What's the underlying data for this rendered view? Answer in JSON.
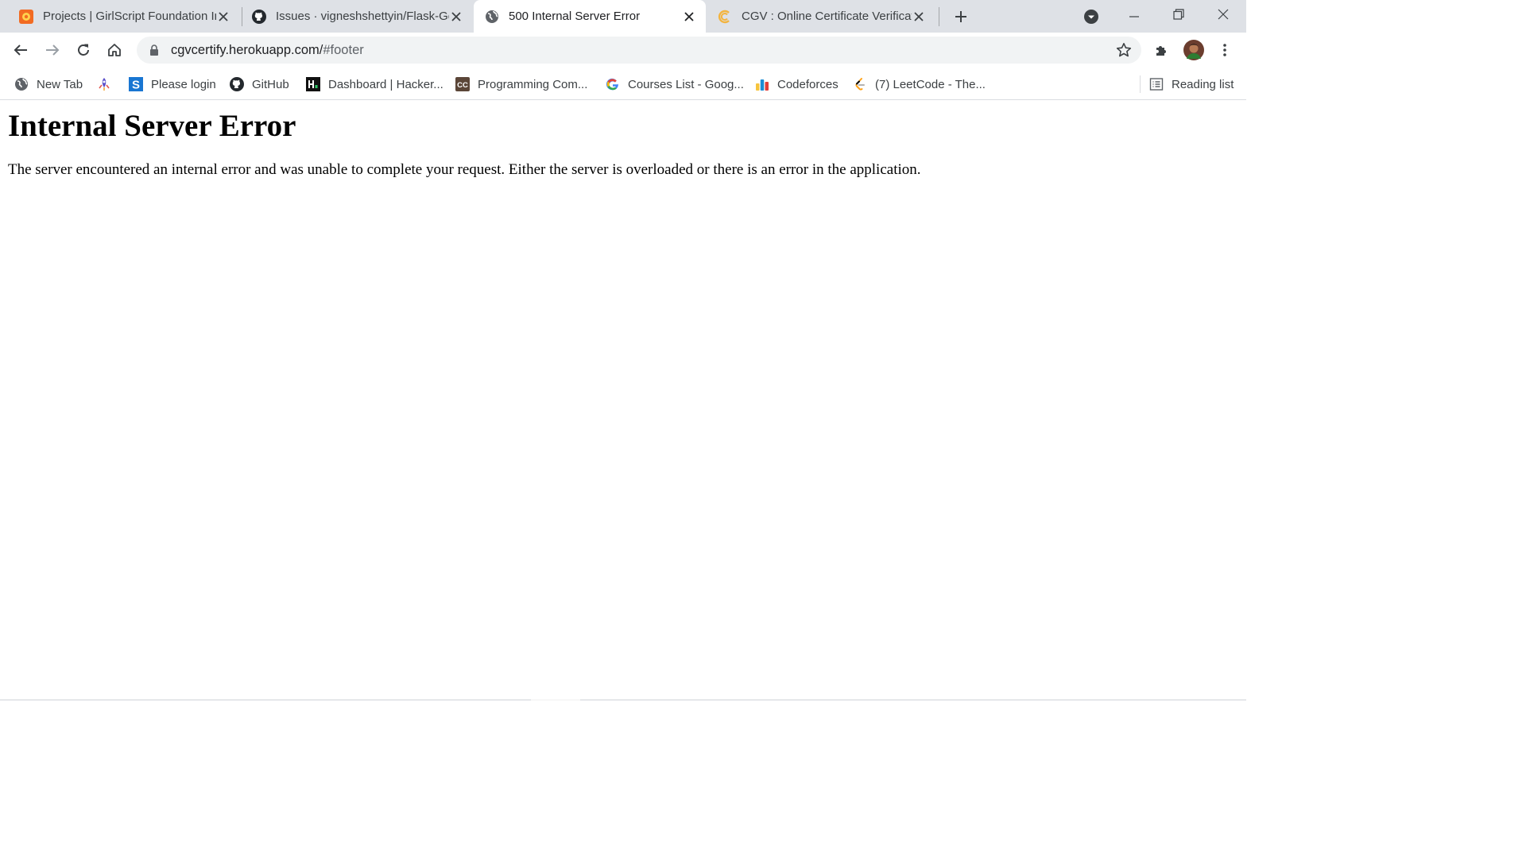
{
  "colors": {
    "tab_strip_bg": "#dee1e6",
    "active_tab_bg": "#ffffff",
    "omnibox_bg": "#f1f3f4",
    "text_primary": "#202124",
    "text_secondary": "#5f6368"
  },
  "tabs": [
    {
      "title": "Projects | GirlScript Foundation In",
      "favicon": "girlscript-icon",
      "active": false
    },
    {
      "title": "Issues · vigneshshettyin/Flask-Ge",
      "favicon": "github-icon",
      "active": false
    },
    {
      "title": "500 Internal Server Error",
      "favicon": "globe-icon",
      "active": true
    },
    {
      "title": "CGV : Online Certificate Verificati",
      "favicon": "cgv-icon",
      "active": false
    }
  ],
  "address_bar": {
    "host": "cgvcertify.herokuapp.com/",
    "fragment": "#footer"
  },
  "bookmarks": [
    {
      "label": "New Tab",
      "icon": "globe-icon"
    },
    {
      "label": "",
      "icon": "spaceship-icon"
    },
    {
      "label": "Please login",
      "icon": "s-icon"
    },
    {
      "label": "GitHub",
      "icon": "github-icon"
    },
    {
      "label": "Dashboard | Hacker...",
      "icon": "hackerrank-icon"
    },
    {
      "label": "Programming Com...",
      "icon": "codechef-icon"
    },
    {
      "label": "Courses List - Goog...",
      "icon": "google-icon"
    },
    {
      "label": "Codeforces",
      "icon": "codeforces-icon"
    },
    {
      "label": "(7) LeetCode - The...",
      "icon": "leetcode-icon"
    }
  ],
  "reading_list": {
    "label": "Reading list",
    "icon": "reading-list-icon"
  },
  "page": {
    "heading": "Internal Server Error",
    "message": "The server encountered an internal error and was unable to complete your request. Either the server is overloaded or there is an error in the application."
  }
}
